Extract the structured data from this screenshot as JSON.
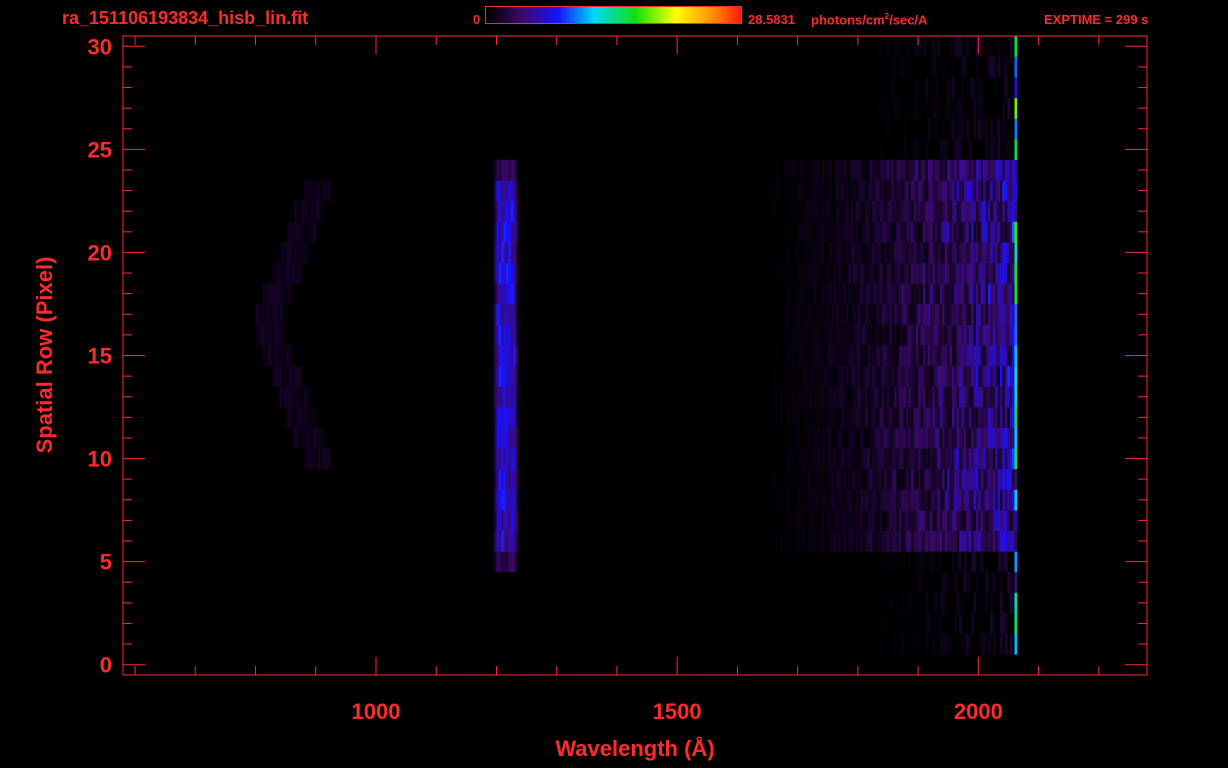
{
  "header": {
    "filename": "ra_151106193834_hisb_lin.fit",
    "colorbar_min": "0",
    "colorbar_max": "28.5831",
    "colorbar_units_pre": "photons/cm",
    "colorbar_units_sup": "2",
    "colorbar_units_post": "/sec/A",
    "exptime": "EXPTIME = 299 s"
  },
  "colors": {
    "axis": "#ff2a2a",
    "background": "#000000"
  },
  "chart_data": {
    "type": "heatmap",
    "title": "ra_151106193834_hisb_lin.fit",
    "xlabel": "Wavelength (Å)",
    "ylabel": "Spatial Row (Pixel)",
    "xlim": [
      580,
      2280
    ],
    "ylim": [
      -0.5,
      30.5
    ],
    "x_ticks": [
      1000,
      1500,
      2000
    ],
    "x_tick_labels": [
      "1000",
      "1500",
      "2000"
    ],
    "y_ticks": [
      0,
      5,
      10,
      15,
      20,
      25,
      30
    ],
    "y_tick_labels": [
      "0",
      "5",
      "10",
      "15",
      "20",
      "25",
      "30"
    ],
    "colorbar": {
      "min": 0,
      "max": 28.5831,
      "units": "photons/cm^2/sec/A",
      "colormap": "black-purple-blue-cyan-green-yellow-red"
    },
    "features": [
      {
        "kind": "emission_line",
        "x_center": 1216,
        "x_width": 30,
        "rows": [
          5,
          24
        ],
        "peak": 7.5
      },
      {
        "kind": "continuum",
        "x_range": [
          1600,
          2060
        ],
        "rows": [
          6,
          24
        ],
        "peak": 5.0,
        "ramp": "increasing_with_wavelength"
      },
      {
        "kind": "continuum_faint",
        "x_range": [
          1800,
          2060
        ],
        "rows": [
          1,
          30
        ],
        "peak": 2.5
      },
      {
        "kind": "detector_edge",
        "x": 2062,
        "rows": [
          1,
          30
        ],
        "peak": 20.0
      },
      {
        "kind": "faint_arc",
        "x_range": [
          800,
          920
        ],
        "rows": [
          10,
          23
        ],
        "peak": 1.5
      }
    ]
  }
}
